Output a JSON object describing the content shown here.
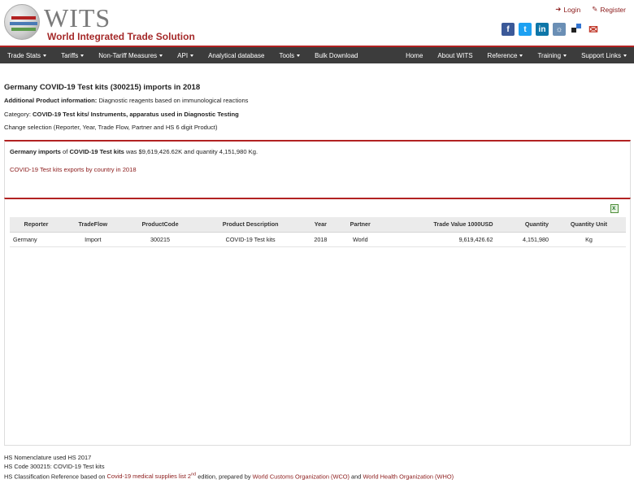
{
  "header": {
    "logo_short": "WITS",
    "logo_full": "World Integrated Trade Solution",
    "login_label": "Login",
    "register_label": "Register",
    "social_icons": [
      "facebook-icon",
      "twitter-icon",
      "linkedin-icon",
      "rss-icon",
      "delicious-icon",
      "email-icon"
    ]
  },
  "nav": {
    "left": [
      {
        "label": "Trade Stats",
        "caret": true
      },
      {
        "label": "Tariffs",
        "caret": true
      },
      {
        "label": "Non-Tariff Measures",
        "caret": true
      },
      {
        "label": "API",
        "caret": true
      },
      {
        "label": "Analytical database",
        "caret": false
      },
      {
        "label": "Tools",
        "caret": true
      },
      {
        "label": "Bulk Download",
        "caret": false
      }
    ],
    "right": [
      {
        "label": "Home",
        "caret": false
      },
      {
        "label": "About WITS",
        "caret": false
      },
      {
        "label": "Reference",
        "caret": true
      },
      {
        "label": "Training",
        "caret": true
      },
      {
        "label": "Support Links",
        "caret": true
      }
    ]
  },
  "page": {
    "title": "Germany COVID-19 Test kits (300215) imports in 2018",
    "additional_label": "Additional Product information:",
    "additional_value": " Diagnostic reagents based on immunological reactions",
    "category_label": "Category: ",
    "category_value": "COVID-19 Test kits/ Instruments, apparatus used in Diagnostic Testing",
    "change_selection": "Change selection (Reporter, Year, Trade Flow, Partner and HS 6 digit Product)"
  },
  "summary": {
    "reporter": "Germany imports",
    "of": " of ",
    "product": "COVID-19 Test kits",
    "rest": " was $9,619,426.62K and quantity 4,151,980 Kg.",
    "exports_link": "COVID-19 Test kits exports by country in 2018"
  },
  "table": {
    "headers": [
      "Reporter",
      "TradeFlow",
      "ProductCode",
      "Product Description",
      "Year",
      "Partner",
      "Trade Value 1000USD",
      "Quantity",
      "Quantity Unit"
    ],
    "rows": [
      [
        "Germany",
        "Import",
        "300215",
        "COVID-19 Test kits",
        "2018",
        "World",
        "9,619,426.62",
        "4,151,980",
        "Kg"
      ]
    ]
  },
  "footer": {
    "line1": "HS Nomenclature used HS 2017",
    "line2": "HS Code 300215: COVID-19 Test kits",
    "line3_a": "HS Classification Reference based on ",
    "line3_link1": "Covid-19 medical supplies list 2",
    "line3_sup": "nd",
    "line3_b": " edition, prepared by ",
    "line3_link2": "World Customs Organization (WCO)",
    "line3_c": " and ",
    "line3_link3": "World Health Organization (WHO)"
  },
  "colors": {
    "accent": "#b22222",
    "nav_bg": "#3c3c3c",
    "link": "#8b1a1a"
  }
}
